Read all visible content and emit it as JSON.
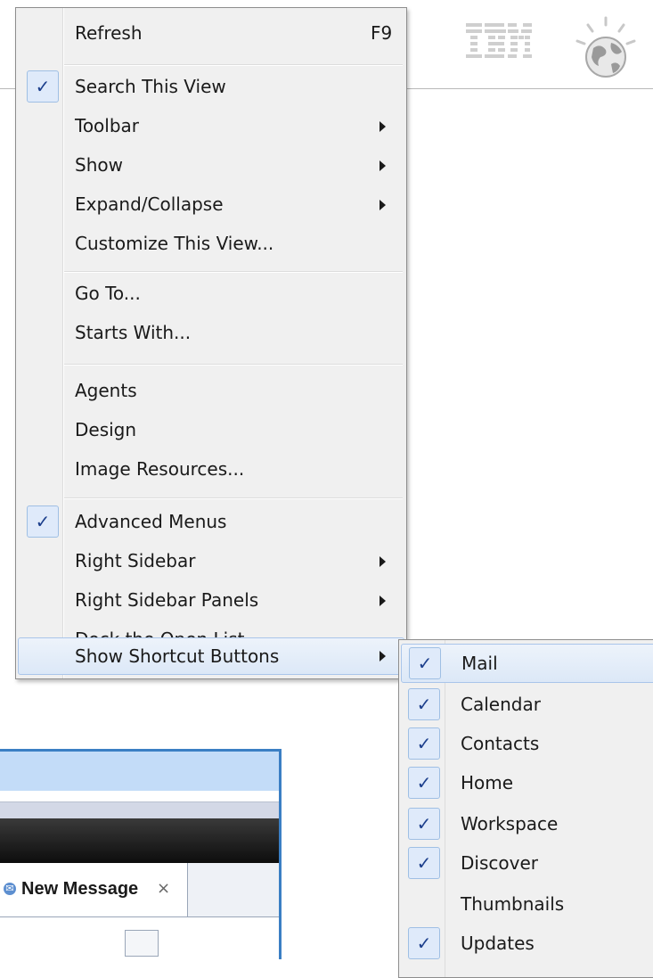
{
  "branding": {
    "logo_text": "IBM",
    "globe_icon": "globe-icon"
  },
  "colors": {
    "check": "#1c3f8c",
    "highlight_border": "#a9c5ea",
    "window_border": "#3b7fc4"
  },
  "menu": {
    "items": [
      {
        "label": "Refresh",
        "accelerator": "F9",
        "checked": false,
        "submenu": false
      },
      {
        "label": "Search This View",
        "checked": true,
        "submenu": false
      },
      {
        "label": "Toolbar",
        "checked": false,
        "submenu": true
      },
      {
        "label": "Show",
        "checked": false,
        "submenu": true
      },
      {
        "label": "Expand/Collapse",
        "checked": false,
        "submenu": true
      },
      {
        "label": "Customize This View...",
        "checked": false,
        "submenu": false
      },
      {
        "label": "Go To...",
        "checked": false,
        "submenu": false
      },
      {
        "label": "Starts With...",
        "checked": false,
        "submenu": false
      },
      {
        "label": "Agents",
        "checked": false,
        "submenu": false
      },
      {
        "label": "Design",
        "checked": false,
        "submenu": false
      },
      {
        "label": "Image Resources...",
        "checked": false,
        "submenu": false
      },
      {
        "label": "Advanced Menus",
        "checked": true,
        "submenu": false
      },
      {
        "label": "Right Sidebar",
        "checked": false,
        "submenu": true
      },
      {
        "label": "Right Sidebar Panels",
        "checked": false,
        "submenu": true
      },
      {
        "label": "Dock the Open List",
        "checked": false,
        "submenu": false
      },
      {
        "label": "Show Shortcut Buttons",
        "checked": false,
        "submenu": true,
        "highlighted": true
      }
    ],
    "check_glyph": "✓"
  },
  "submenu": {
    "items": [
      {
        "label": "Mail",
        "checked": true,
        "highlighted": true
      },
      {
        "label": "Calendar",
        "checked": true
      },
      {
        "label": "Contacts",
        "checked": true
      },
      {
        "label": "Home",
        "checked": true
      },
      {
        "label": "Workspace",
        "checked": true
      },
      {
        "label": "Discover",
        "checked": true
      },
      {
        "label": "Thumbnails",
        "checked": false
      },
      {
        "label": "Updates",
        "checked": true
      }
    ]
  },
  "window": {
    "tab_label": "New Message",
    "tab_close": "×"
  }
}
